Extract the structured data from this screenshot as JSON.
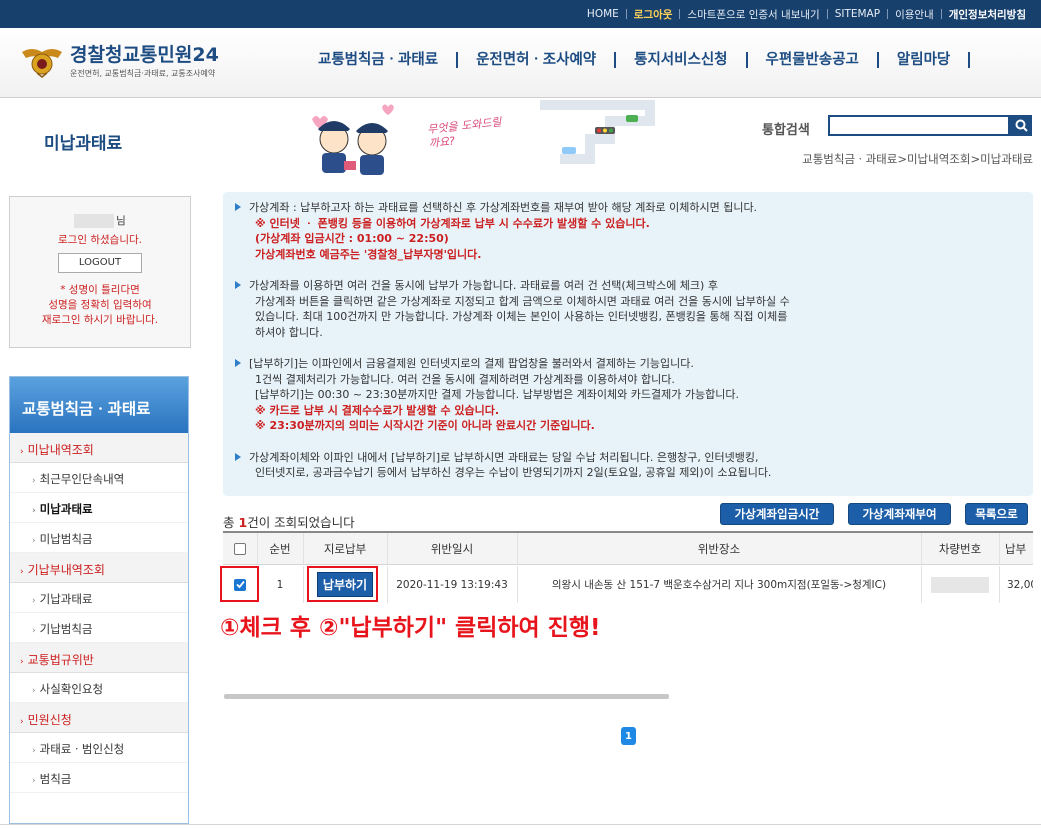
{
  "topbar": {
    "links": [
      "HOME",
      "로그아웃",
      "스마트폰으로 인증서 내보내기",
      "SITEMAP",
      "이용안내",
      "개인정보처리방침"
    ]
  },
  "logo": {
    "title_main": "경찰청",
    "title_sub": "교통민원24",
    "subtitle": "운전면허, 교통범칙금·과태료, 교통조사예약"
  },
  "gnb": [
    "교통범칙금ㆍ과태료",
    "운전면허ㆍ조사예약",
    "통지서비스신청",
    "우편물반송공고",
    "알림마당"
  ],
  "page": {
    "title": "미납과태료",
    "search_label": "통합검색",
    "search_placeholder": "",
    "breadcrumb": "교통범칙금ㆍ과태료>미납내역조회>미납과태료",
    "banner_text": "무엇을 도와드릴까요?"
  },
  "login": {
    "name_suffix": "님",
    "msg": "로그인 하셨습니다.",
    "logout": "LOGOUT",
    "warn1": "* 성명이 틀리다면",
    "warn2": "성명을 정확히 입력하여",
    "warn3": "재로그인 하시기 바랍니다."
  },
  "lnb": {
    "title": "교통범칙금ㆍ과태료",
    "groups": [
      {
        "label": "미납내역조회",
        "items": [
          "최근무인단속내역",
          "미납과태료",
          "미납범칙금"
        ]
      },
      {
        "label": "기납부내역조회",
        "items": [
          "기납과태료",
          "기납범칙금"
        ]
      },
      {
        "label": "교통법규위반",
        "items": [
          "사실확인요청"
        ]
      },
      {
        "label": "민원신청",
        "items": [
          "과태료ㆍ범인신청",
          "범칙금"
        ]
      }
    ]
  },
  "info": {
    "p1": [
      "가상계좌 : 납부하고자 하는 과태료를 선택하신 후 가상계좌번호를 재부여 받아 해당 계좌로 이체하시면 됩니다."
    ],
    "p1_red": [
      "※ 인터넷 ㆍ 폰뱅킹 등을 이용하여 가상계좌로 납부 시 수수료가 발생할 수 있습니다.",
      "(가상계좌 입금시간 : 01:00 ~ 22:50)",
      "가상계좌번호 예금주는 '경찰청_납부자명'입니다."
    ],
    "p2": [
      "가상계좌를 이용하면 여러 건을 동시에 납부가 가능합니다. 과태료를 여러 건 선택(체크박스에 체크) 후",
      "가상계좌 버튼을 클릭하면 같은 가상계좌로 지정되고 합계 금액으로 이체하시면 과태료 여러 건을 동시에 납부하실 수",
      "있습니다. 최대 100건까지 만 가능합니다. 가상계좌 이체는 본인이 사용하는 인터넷뱅킹, 폰뱅킹을 통해 직접 이체를",
      "하셔야 합니다."
    ],
    "p3": [
      "[납부하기]는 이파인에서 금융결제원 인터넷지로의 결제 팝업창을 불러와서 결제하는 기능입니다.",
      "1건씩 결제처리가 가능합니다. 여러 건을 동시에 결제하려면 가상계좌를 이용하셔야 합니다.",
      "[납부하기]는 00:30 ~ 23:30분까지만 결제 가능합니다. 납부방법은 계좌이체와 카드결제가 가능합니다."
    ],
    "p3_red": [
      "※ 카드로 납부 시 결제수수료가 발생할 수 있습니다.",
      "※ 23:30분까지의 의미는 시작시간 기준이 아니라 완료시간 기준입니다."
    ],
    "p4": [
      "가상계좌이체와 이파인 내에서 [납부하기]로 납부하시면 과태료는 당일 수납 처리됩니다. 은행창구, 인터넷뱅킹,",
      "인터넷지로, 공과금수납기 등에서 납부하신 경우는 수납이 반영되기까지 2일(토요일, 공휴일 제외)이 소요됩니다."
    ]
  },
  "result": {
    "prefix": "총 ",
    "count": "1",
    "suffix": "건이 조회되었습니다",
    "btn_time": "가상계좌입금시간",
    "btn_reissue": "가상계좌재부여",
    "btn_list": "목록으로"
  },
  "table": {
    "headers": [
      "순번",
      "지로납부",
      "위반일시",
      "위반장소",
      "차량번호",
      "납부"
    ],
    "rows": [
      {
        "no": "1",
        "pay": "납부하기",
        "datetime": "2020-11-19 13:19:43",
        "place": "의왕시 내손동 산 151-7 백운호수삼거리 지나 300m지점(포일동->청계IC)",
        "amount": "32,00"
      }
    ]
  },
  "annotation": "①체크 후 ②\"납부하기\" 클릭하여 진행!",
  "pagination": {
    "current": "1"
  },
  "colors": {
    "primary": "#1d4c82",
    "accent_red": "#cc1f1f",
    "highlight": "#e8141c",
    "button_blue": "#1d5ea8"
  }
}
